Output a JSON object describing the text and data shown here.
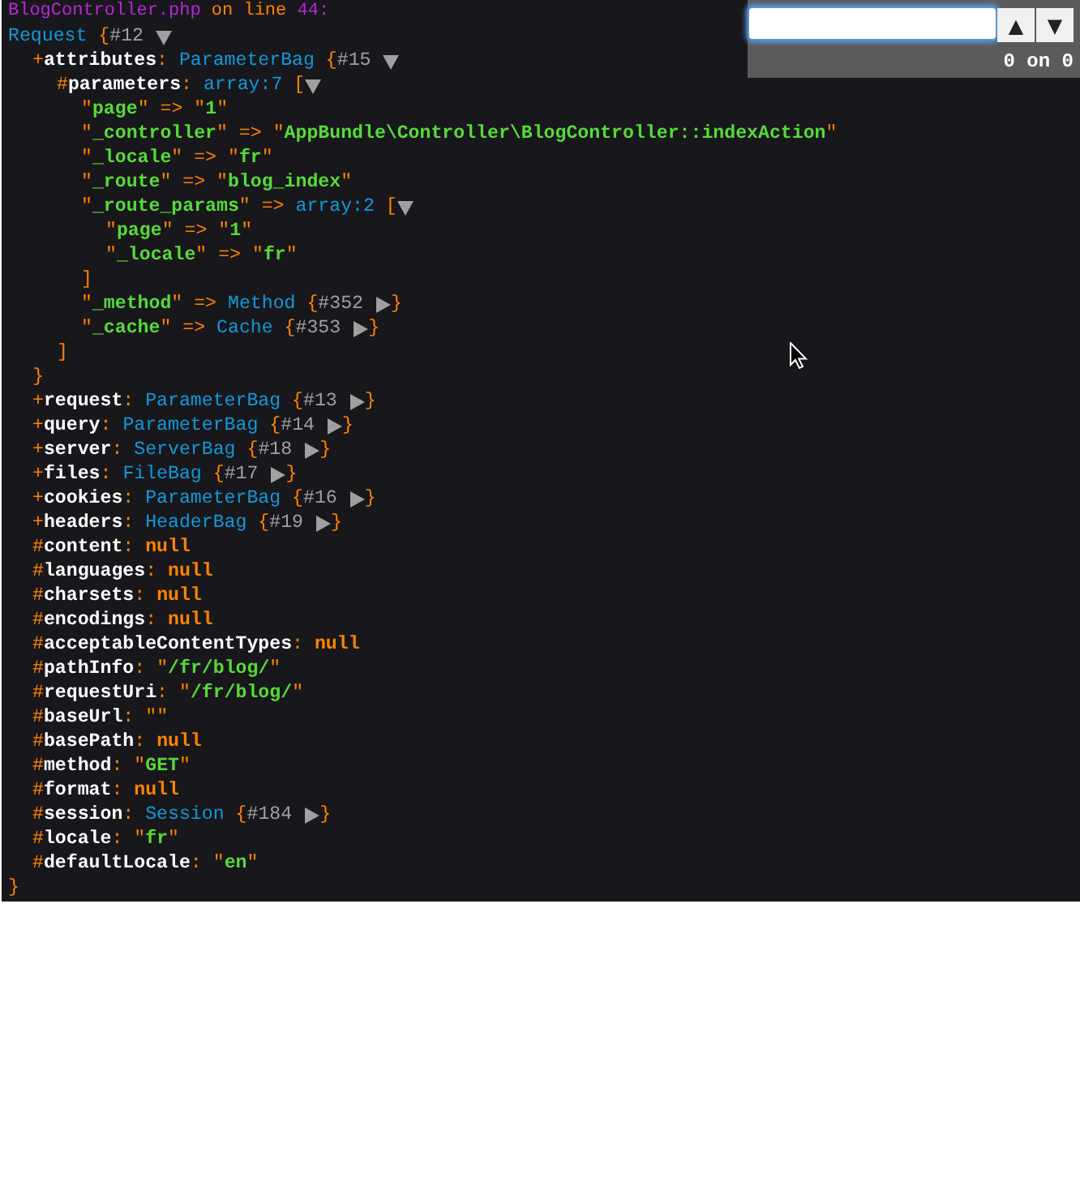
{
  "dump": {
    "header": [
      {
        "kind": "file",
        "text": "BlogController.php"
      },
      {
        "kind": "label",
        "text": " on line "
      },
      {
        "kind": "file",
        "text": "44:"
      }
    ],
    "root": {
      "tokens": [
        {
          "kind": "class",
          "text": "Request "
        },
        {
          "kind": "brace",
          "text": "{"
        },
        {
          "kind": "ref",
          "text": "#12"
        }
      ],
      "expanded": true,
      "close": "}",
      "children": [
        {
          "tokens": [
            {
              "kind": "sigil",
              "text": "+"
            },
            {
              "kind": "prop",
              "text": "attributes"
            },
            {
              "kind": "colon",
              "text": ": "
            },
            {
              "kind": "class",
              "text": "ParameterBag "
            },
            {
              "kind": "brace",
              "text": "{"
            },
            {
              "kind": "ref",
              "text": "#15"
            }
          ],
          "expanded": true,
          "close": "}",
          "children": [
            {
              "tokens": [
                {
                  "kind": "sigil",
                  "text": "#"
                },
                {
                  "kind": "prop",
                  "text": "parameters"
                },
                {
                  "kind": "colon",
                  "text": ": "
                },
                {
                  "kind": "class",
                  "text": "array:7 "
                },
                {
                  "kind": "brace",
                  "text": "["
                }
              ],
              "expanded": true,
              "close": "]",
              "children": [
                {
                  "tokens": [
                    {
                      "kind": "quote",
                      "text": "\""
                    },
                    {
                      "kind": "key",
                      "text": "page"
                    },
                    {
                      "kind": "quote",
                      "text": "\""
                    },
                    {
                      "kind": "arrow",
                      "text": " => "
                    },
                    {
                      "kind": "quote",
                      "text": "\""
                    },
                    {
                      "kind": "string",
                      "text": "1"
                    },
                    {
                      "kind": "quote",
                      "text": "\""
                    }
                  ]
                },
                {
                  "tokens": [
                    {
                      "kind": "quote",
                      "text": "\""
                    },
                    {
                      "kind": "key",
                      "text": "_controller"
                    },
                    {
                      "kind": "quote",
                      "text": "\""
                    },
                    {
                      "kind": "arrow",
                      "text": " => "
                    },
                    {
                      "kind": "quote",
                      "text": "\""
                    },
                    {
                      "kind": "string",
                      "text": "AppBundle\\Controller\\BlogController::indexAction"
                    },
                    {
                      "kind": "quote",
                      "text": "\""
                    }
                  ]
                },
                {
                  "tokens": [
                    {
                      "kind": "quote",
                      "text": "\""
                    },
                    {
                      "kind": "key",
                      "text": "_locale"
                    },
                    {
                      "kind": "quote",
                      "text": "\""
                    },
                    {
                      "kind": "arrow",
                      "text": " => "
                    },
                    {
                      "kind": "quote",
                      "text": "\""
                    },
                    {
                      "kind": "string",
                      "text": "fr"
                    },
                    {
                      "kind": "quote",
                      "text": "\""
                    }
                  ]
                },
                {
                  "tokens": [
                    {
                      "kind": "quote",
                      "text": "\""
                    },
                    {
                      "kind": "key",
                      "text": "_route"
                    },
                    {
                      "kind": "quote",
                      "text": "\""
                    },
                    {
                      "kind": "arrow",
                      "text": " => "
                    },
                    {
                      "kind": "quote",
                      "text": "\""
                    },
                    {
                      "kind": "string",
                      "text": "blog_index"
                    },
                    {
                      "kind": "quote",
                      "text": "\""
                    }
                  ]
                },
                {
                  "tokens": [
                    {
                      "kind": "quote",
                      "text": "\""
                    },
                    {
                      "kind": "key",
                      "text": "_route_params"
                    },
                    {
                      "kind": "quote",
                      "text": "\""
                    },
                    {
                      "kind": "arrow",
                      "text": " => "
                    },
                    {
                      "kind": "class",
                      "text": "array:2 "
                    },
                    {
                      "kind": "brace",
                      "text": "["
                    }
                  ],
                  "expanded": true,
                  "close": "]",
                  "children": [
                    {
                      "tokens": [
                        {
                          "kind": "quote",
                          "text": "\""
                        },
                        {
                          "kind": "key",
                          "text": "page"
                        },
                        {
                          "kind": "quote",
                          "text": "\""
                        },
                        {
                          "kind": "arrow",
                          "text": " => "
                        },
                        {
                          "kind": "quote",
                          "text": "\""
                        },
                        {
                          "kind": "string",
                          "text": "1"
                        },
                        {
                          "kind": "quote",
                          "text": "\""
                        }
                      ]
                    },
                    {
                      "tokens": [
                        {
                          "kind": "quote",
                          "text": "\""
                        },
                        {
                          "kind": "key",
                          "text": "_locale"
                        },
                        {
                          "kind": "quote",
                          "text": "\""
                        },
                        {
                          "kind": "arrow",
                          "text": " => "
                        },
                        {
                          "kind": "quote",
                          "text": "\""
                        },
                        {
                          "kind": "string",
                          "text": "fr"
                        },
                        {
                          "kind": "quote",
                          "text": "\""
                        }
                      ]
                    }
                  ]
                },
                {
                  "tokens": [
                    {
                      "kind": "quote",
                      "text": "\""
                    },
                    {
                      "kind": "key",
                      "text": "_method"
                    },
                    {
                      "kind": "quote",
                      "text": "\""
                    },
                    {
                      "kind": "arrow",
                      "text": " => "
                    },
                    {
                      "kind": "class",
                      "text": "Method "
                    },
                    {
                      "kind": "brace",
                      "text": "{"
                    },
                    {
                      "kind": "ref",
                      "text": "#352"
                    }
                  ],
                  "expanded": false,
                  "close": "}"
                },
                {
                  "tokens": [
                    {
                      "kind": "quote",
                      "text": "\""
                    },
                    {
                      "kind": "key",
                      "text": "_cache"
                    },
                    {
                      "kind": "quote",
                      "text": "\""
                    },
                    {
                      "kind": "arrow",
                      "text": " => "
                    },
                    {
                      "kind": "class",
                      "text": "Cache "
                    },
                    {
                      "kind": "brace",
                      "text": "{"
                    },
                    {
                      "kind": "ref",
                      "text": "#353"
                    }
                  ],
                  "expanded": false,
                  "close": "}"
                }
              ]
            }
          ]
        },
        {
          "tokens": [
            {
              "kind": "sigil",
              "text": "+"
            },
            {
              "kind": "prop",
              "text": "request"
            },
            {
              "kind": "colon",
              "text": ": "
            },
            {
              "kind": "class",
              "text": "ParameterBag "
            },
            {
              "kind": "brace",
              "text": "{"
            },
            {
              "kind": "ref",
              "text": "#13"
            }
          ],
          "expanded": false,
          "close": "}"
        },
        {
          "tokens": [
            {
              "kind": "sigil",
              "text": "+"
            },
            {
              "kind": "prop",
              "text": "query"
            },
            {
              "kind": "colon",
              "text": ": "
            },
            {
              "kind": "class",
              "text": "ParameterBag "
            },
            {
              "kind": "brace",
              "text": "{"
            },
            {
              "kind": "ref",
              "text": "#14"
            }
          ],
          "expanded": false,
          "close": "}"
        },
        {
          "tokens": [
            {
              "kind": "sigil",
              "text": "+"
            },
            {
              "kind": "prop",
              "text": "server"
            },
            {
              "kind": "colon",
              "text": ": "
            },
            {
              "kind": "class",
              "text": "ServerBag "
            },
            {
              "kind": "brace",
              "text": "{"
            },
            {
              "kind": "ref",
              "text": "#18"
            }
          ],
          "expanded": false,
          "close": "}"
        },
        {
          "tokens": [
            {
              "kind": "sigil",
              "text": "+"
            },
            {
              "kind": "prop",
              "text": "files"
            },
            {
              "kind": "colon",
              "text": ": "
            },
            {
              "kind": "class",
              "text": "FileBag "
            },
            {
              "kind": "brace",
              "text": "{"
            },
            {
              "kind": "ref",
              "text": "#17"
            }
          ],
          "expanded": false,
          "close": "}"
        },
        {
          "tokens": [
            {
              "kind": "sigil",
              "text": "+"
            },
            {
              "kind": "prop",
              "text": "cookies"
            },
            {
              "kind": "colon",
              "text": ": "
            },
            {
              "kind": "class",
              "text": "ParameterBag "
            },
            {
              "kind": "brace",
              "text": "{"
            },
            {
              "kind": "ref",
              "text": "#16"
            }
          ],
          "expanded": false,
          "close": "}"
        },
        {
          "tokens": [
            {
              "kind": "sigil",
              "text": "+"
            },
            {
              "kind": "prop",
              "text": "headers"
            },
            {
              "kind": "colon",
              "text": ": "
            },
            {
              "kind": "class",
              "text": "HeaderBag "
            },
            {
              "kind": "brace",
              "text": "{"
            },
            {
              "kind": "ref",
              "text": "#19"
            }
          ],
          "expanded": false,
          "close": "}"
        },
        {
          "tokens": [
            {
              "kind": "sigil",
              "text": "#"
            },
            {
              "kind": "prop",
              "text": "content"
            },
            {
              "kind": "colon",
              "text": ": "
            },
            {
              "kind": "null",
              "text": "null"
            }
          ]
        },
        {
          "tokens": [
            {
              "kind": "sigil",
              "text": "#"
            },
            {
              "kind": "prop",
              "text": "languages"
            },
            {
              "kind": "colon",
              "text": ": "
            },
            {
              "kind": "null",
              "text": "null"
            }
          ]
        },
        {
          "tokens": [
            {
              "kind": "sigil",
              "text": "#"
            },
            {
              "kind": "prop",
              "text": "charsets"
            },
            {
              "kind": "colon",
              "text": ": "
            },
            {
              "kind": "null",
              "text": "null"
            }
          ]
        },
        {
          "tokens": [
            {
              "kind": "sigil",
              "text": "#"
            },
            {
              "kind": "prop",
              "text": "encodings"
            },
            {
              "kind": "colon",
              "text": ": "
            },
            {
              "kind": "null",
              "text": "null"
            }
          ]
        },
        {
          "tokens": [
            {
              "kind": "sigil",
              "text": "#"
            },
            {
              "kind": "prop",
              "text": "acceptableContentTypes"
            },
            {
              "kind": "colon",
              "text": ": "
            },
            {
              "kind": "null",
              "text": "null"
            }
          ]
        },
        {
          "tokens": [
            {
              "kind": "sigil",
              "text": "#"
            },
            {
              "kind": "prop",
              "text": "pathInfo"
            },
            {
              "kind": "colon",
              "text": ": "
            },
            {
              "kind": "quote",
              "text": "\""
            },
            {
              "kind": "string",
              "text": "/fr/blog/"
            },
            {
              "kind": "quote",
              "text": "\""
            }
          ]
        },
        {
          "tokens": [
            {
              "kind": "sigil",
              "text": "#"
            },
            {
              "kind": "prop",
              "text": "requestUri"
            },
            {
              "kind": "colon",
              "text": ": "
            },
            {
              "kind": "quote",
              "text": "\""
            },
            {
              "kind": "string",
              "text": "/fr/blog/"
            },
            {
              "kind": "quote",
              "text": "\""
            }
          ]
        },
        {
          "tokens": [
            {
              "kind": "sigil",
              "text": "#"
            },
            {
              "kind": "prop",
              "text": "baseUrl"
            },
            {
              "kind": "colon",
              "text": ": "
            },
            {
              "kind": "quote",
              "text": "\""
            },
            {
              "kind": "quote",
              "text": "\""
            }
          ]
        },
        {
          "tokens": [
            {
              "kind": "sigil",
              "text": "#"
            },
            {
              "kind": "prop",
              "text": "basePath"
            },
            {
              "kind": "colon",
              "text": ": "
            },
            {
              "kind": "null",
              "text": "null"
            }
          ]
        },
        {
          "tokens": [
            {
              "kind": "sigil",
              "text": "#"
            },
            {
              "kind": "prop",
              "text": "method"
            },
            {
              "kind": "colon",
              "text": ": "
            },
            {
              "kind": "quote",
              "text": "\""
            },
            {
              "kind": "string",
              "text": "GET"
            },
            {
              "kind": "quote",
              "text": "\""
            }
          ]
        },
        {
          "tokens": [
            {
              "kind": "sigil",
              "text": "#"
            },
            {
              "kind": "prop",
              "text": "format"
            },
            {
              "kind": "colon",
              "text": ": "
            },
            {
              "kind": "null",
              "text": "null"
            }
          ]
        },
        {
          "tokens": [
            {
              "kind": "sigil",
              "text": "#"
            },
            {
              "kind": "prop",
              "text": "session"
            },
            {
              "kind": "colon",
              "text": ": "
            },
            {
              "kind": "class",
              "text": "Session "
            },
            {
              "kind": "brace",
              "text": "{"
            },
            {
              "kind": "ref",
              "text": "#184"
            }
          ],
          "expanded": false,
          "close": "}"
        },
        {
          "tokens": [
            {
              "kind": "sigil",
              "text": "#"
            },
            {
              "kind": "prop",
              "text": "locale"
            },
            {
              "kind": "colon",
              "text": ": "
            },
            {
              "kind": "quote",
              "text": "\""
            },
            {
              "kind": "string",
              "text": "fr"
            },
            {
              "kind": "quote",
              "text": "\""
            }
          ]
        },
        {
          "tokens": [
            {
              "kind": "sigil",
              "text": "#"
            },
            {
              "kind": "prop",
              "text": "defaultLocale"
            },
            {
              "kind": "colon",
              "text": ": "
            },
            {
              "kind": "quote",
              "text": "\""
            },
            {
              "kind": "string",
              "text": "en"
            },
            {
              "kind": "quote",
              "text": "\""
            }
          ]
        }
      ]
    }
  },
  "search": {
    "buttons": [
      "▲",
      "▼"
    ],
    "counter": "0 on 0"
  }
}
